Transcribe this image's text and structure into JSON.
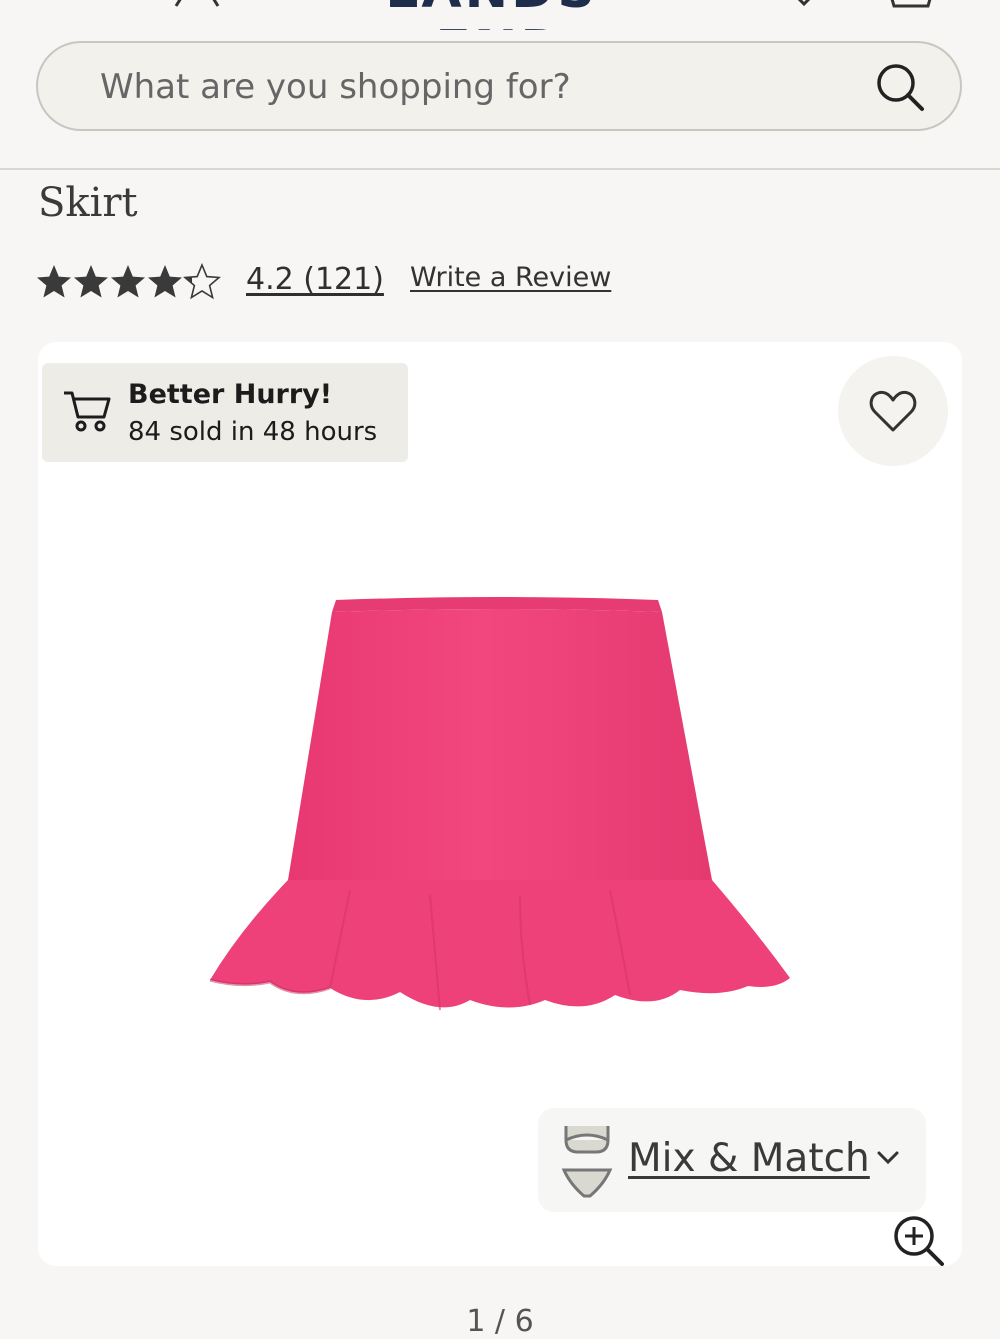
{
  "header": {
    "brand": "LANDS' END"
  },
  "search": {
    "placeholder": "What are you shopping for?"
  },
  "product": {
    "title": "Skirt",
    "rating_value": "4.2",
    "rating_count": "(121)",
    "rating_text": "4.2 (121)",
    "write_review": "Write a Review",
    "rating_stars": 4.2,
    "product_color": "#f0407c"
  },
  "urgency": {
    "title": "Better Hurry!",
    "subtitle": "84 sold in 48 hours"
  },
  "mix_match": {
    "label": "Mix & Match"
  },
  "gallery": {
    "pager": "1 / 6"
  },
  "icons": [
    "account-icon",
    "wishlist-icon",
    "cart-icon",
    "search-icon",
    "star-icon",
    "shopping-cart-icon",
    "heart-icon",
    "bikini-icon",
    "chevron-down-icon",
    "zoom-in-icon"
  ]
}
